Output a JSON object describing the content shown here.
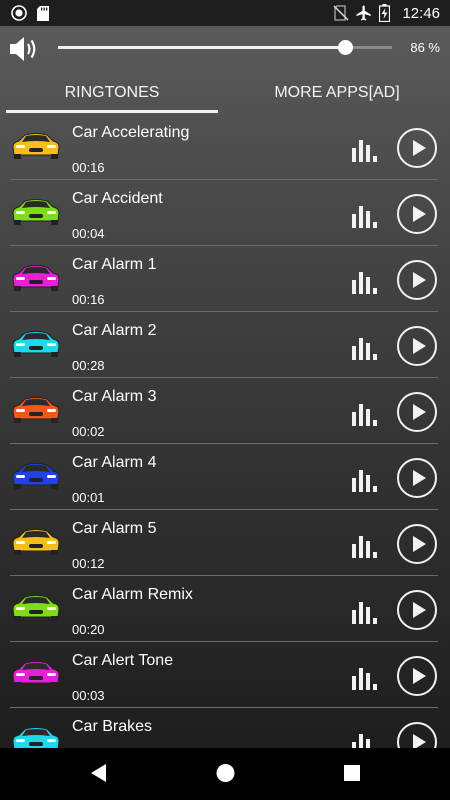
{
  "status_bar": {
    "time": "12:46",
    "left_icons": [
      "record-icon",
      "sd-card-icon"
    ],
    "right_icons": [
      "no-sim-icon",
      "airplane-mode-icon",
      "battery-charging-icon"
    ]
  },
  "volume": {
    "icon": "speaker-icon",
    "percent_label": "86 %",
    "level_fraction": 0.86
  },
  "tabs": [
    {
      "label": "RINGTONES",
      "selected": true
    },
    {
      "label": "MORE APPS[AD]",
      "selected": false
    }
  ],
  "ringtones": [
    {
      "title": "Car Accelerating",
      "duration": "00:16",
      "car_color": "#f2c018"
    },
    {
      "title": "Car Accident",
      "duration": "00:04",
      "car_color": "#7fdc18"
    },
    {
      "title": "Car Alarm 1",
      "duration": "00:16",
      "car_color": "#e81fd6"
    },
    {
      "title": "Car Alarm 2",
      "duration": "00:28",
      "car_color": "#1ed8ec"
    },
    {
      "title": "Car Alarm 3",
      "duration": "00:02",
      "car_color": "#f0561e"
    },
    {
      "title": "Car Alarm 4",
      "duration": "00:01",
      "car_color": "#2040e8"
    },
    {
      "title": "Car Alarm 5",
      "duration": "00:12",
      "car_color": "#f2c018"
    },
    {
      "title": "Car Alarm Remix",
      "duration": "00:20",
      "car_color": "#7fdc18"
    },
    {
      "title": "Car Alert Tone",
      "duration": "00:03",
      "car_color": "#e81fd6"
    },
    {
      "title": "Car Brakes",
      "duration": "",
      "car_color": "#1ed8ec"
    }
  ],
  "row_icons": {
    "equalizer": "equalizer-icon",
    "play": "play-icon"
  },
  "nav_bar": {
    "icons": [
      "back-icon",
      "home-icon",
      "recents-icon"
    ]
  }
}
